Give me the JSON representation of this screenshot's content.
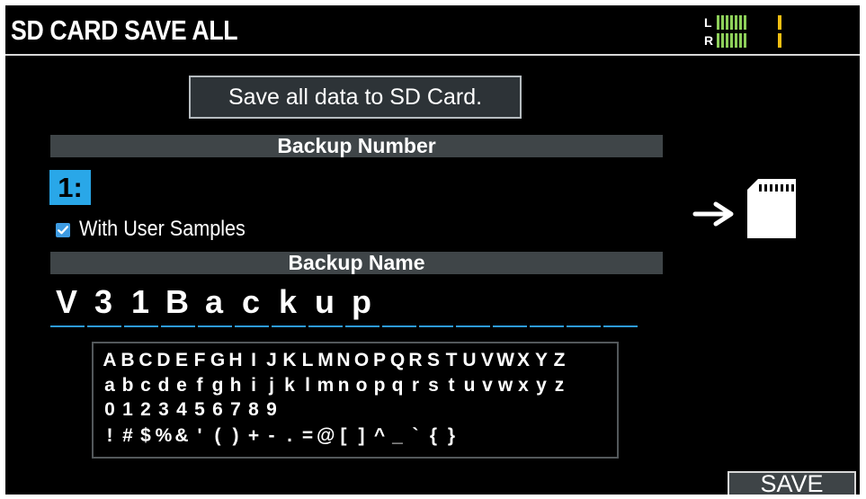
{
  "header": {
    "title": "SD CARD SAVE ALL",
    "meter": {
      "left_label": "L",
      "right_label": "R",
      "level_color": "#8ed05a",
      "peak_color": "#f2bf12"
    }
  },
  "main": {
    "info_box": "Save all data to SD Card.",
    "backup_number_label": "Backup Number",
    "backup_number_value": "1:",
    "checkbox_label": "With User Samples",
    "checkbox_checked": true,
    "backup_name_label": "Backup Name",
    "backup_name_chars": [
      "V",
      "3",
      "1",
      "B",
      "a",
      "c",
      "k",
      "u",
      "p",
      "",
      "",
      "",
      "",
      "",
      "",
      ""
    ],
    "keyboard_rows": [
      [
        "A",
        "B",
        "C",
        "D",
        "E",
        "F",
        "G",
        "H",
        "I",
        "J",
        "K",
        "L",
        "M",
        "N",
        "O",
        "P",
        "Q",
        "R",
        "S",
        "T",
        "U",
        "V",
        "W",
        "X",
        "Y",
        "Z"
      ],
      [
        "a",
        "b",
        "c",
        "d",
        "e",
        "f",
        "g",
        "h",
        "i",
        "j",
        "k",
        "l",
        "m",
        "n",
        "o",
        "p",
        "q",
        "r",
        "s",
        "t",
        "u",
        "v",
        "w",
        "x",
        "y",
        "z"
      ],
      [
        "0",
        "1",
        "2",
        "3",
        "4",
        "5",
        "6",
        "7",
        "8",
        "9"
      ],
      [
        "!",
        "#",
        "$",
        "%",
        "&",
        "'",
        "(",
        ")",
        "+",
        "-",
        ".",
        "=",
        "@",
        "[",
        "]",
        "^",
        "_",
        "`",
        "{",
        "}"
      ]
    ],
    "icons": {
      "arrow": "right-arrow-icon",
      "sd_card": "sd-card-icon",
      "checkbox": "checkbox-icon"
    },
    "accent_color": "#29a7e8"
  },
  "footer": {
    "save_label": "SAVE"
  }
}
